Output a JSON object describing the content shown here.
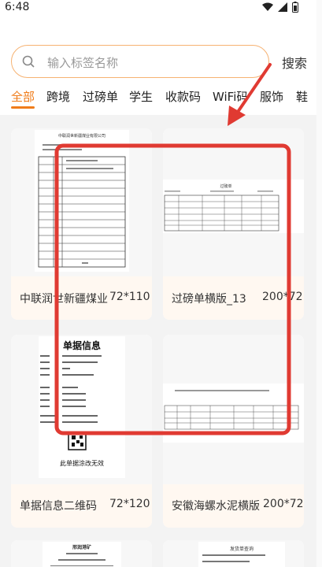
{
  "status": {
    "time": "6:48"
  },
  "search": {
    "placeholder": "输入标签名称",
    "button_label": "搜索"
  },
  "tabs": [
    {
      "label": "全部"
    },
    {
      "label": "跨境"
    },
    {
      "label": "过磅单"
    },
    {
      "label": "学生"
    },
    {
      "label": "收款码"
    },
    {
      "label": "WiFi码"
    },
    {
      "label": "服饰"
    },
    {
      "label": "鞋"
    }
  ],
  "cards": [
    {
      "name": "中联润世新疆煤业",
      "size": "72*110",
      "doc_title": "中联润世新疆煤业有限公司"
    },
    {
      "name": "过磅单横版_13",
      "size": "200*72",
      "doc_title": "过磅单"
    },
    {
      "name": "单据信息二维码",
      "size": "72*120",
      "doc_title": "单据信息",
      "doc_footer": "此单据涂改无效"
    },
    {
      "name": "安徽海螺水泥横版",
      "size": "200*72"
    },
    {
      "name": "",
      "size": "",
      "doc_title": "邢润港矿"
    },
    {
      "name": "",
      "size": "",
      "doc_title": "发货单查询"
    }
  ],
  "colors": {
    "accent": "#f07c1a",
    "annotation": "#e03a32"
  }
}
